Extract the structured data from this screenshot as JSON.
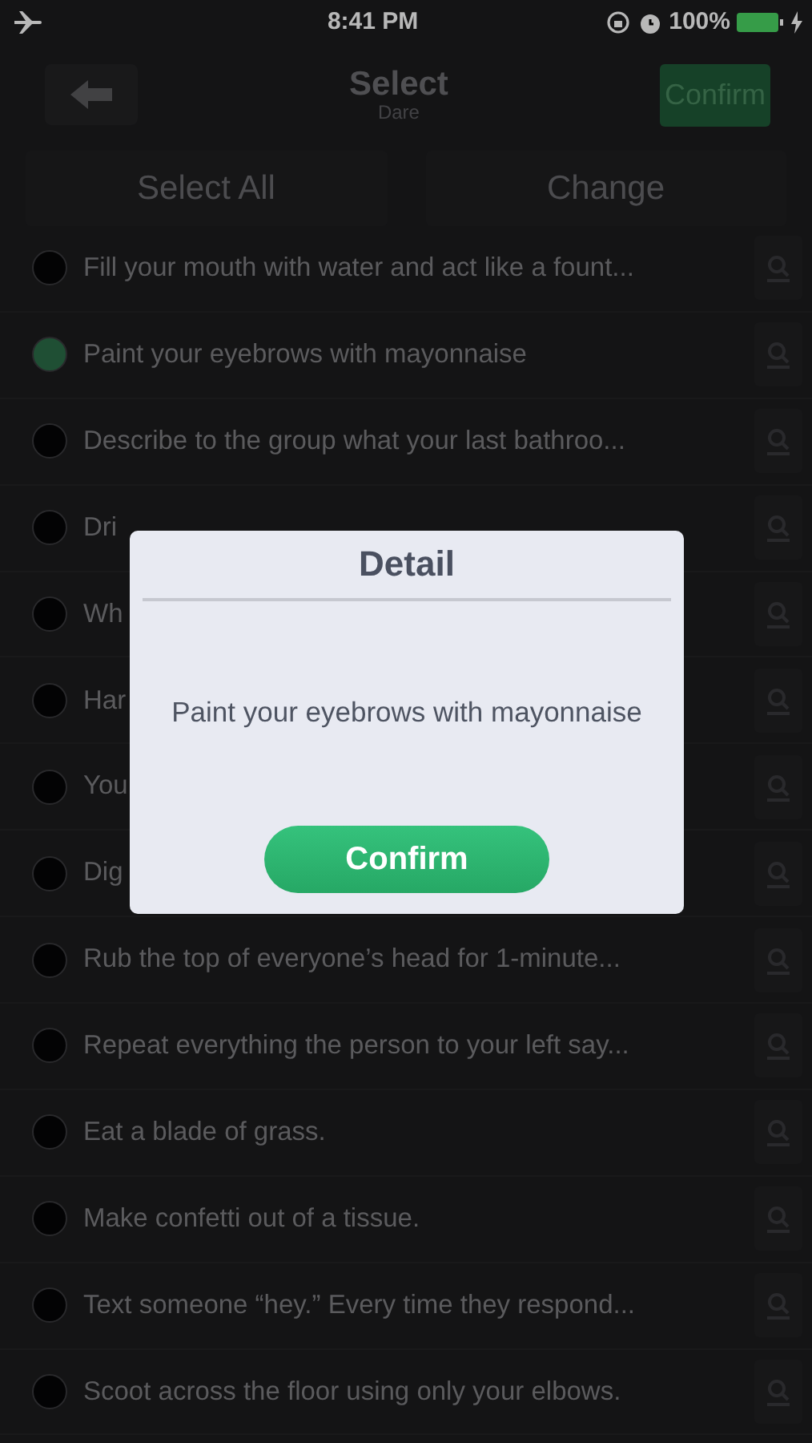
{
  "status_bar": {
    "time": "8:41 PM",
    "battery": "100%"
  },
  "nav": {
    "title": "Select",
    "subtitle": "Dare",
    "confirm": "Confirm"
  },
  "actions": [
    "Select All",
    "Change"
  ],
  "rows": [
    {
      "text": "Fill your mouth with water and act like a fount...",
      "selected": false
    },
    {
      "text": "Paint your eyebrows with mayonnaise",
      "selected": true
    },
    {
      "text": "Describe to the group what your last bathroo...",
      "selected": false
    },
    {
      "text": "Dri",
      "selected": false
    },
    {
      "text": "Wh",
      "selected": false
    },
    {
      "text": "Har",
      "selected": false
    },
    {
      "text": "You",
      "selected": false
    },
    {
      "text": "Dig",
      "selected": false
    },
    {
      "text": "Rub the top of everyone’s head for 1-minute...",
      "selected": false
    },
    {
      "text": "Repeat everything the person to your left say...",
      "selected": false
    },
    {
      "text": "Eat a blade of grass.",
      "selected": false
    },
    {
      "text": "Make confetti out of a tissue.",
      "selected": false
    },
    {
      "text": "Text someone “hey.” Every time they respond...",
      "selected": false
    },
    {
      "text": "Scoot across the floor using only your elbows.",
      "selected": false
    }
  ],
  "dialog": {
    "title": "Detail",
    "message": "Paint your eyebrows with mayonnaise",
    "button": "Confirm"
  }
}
